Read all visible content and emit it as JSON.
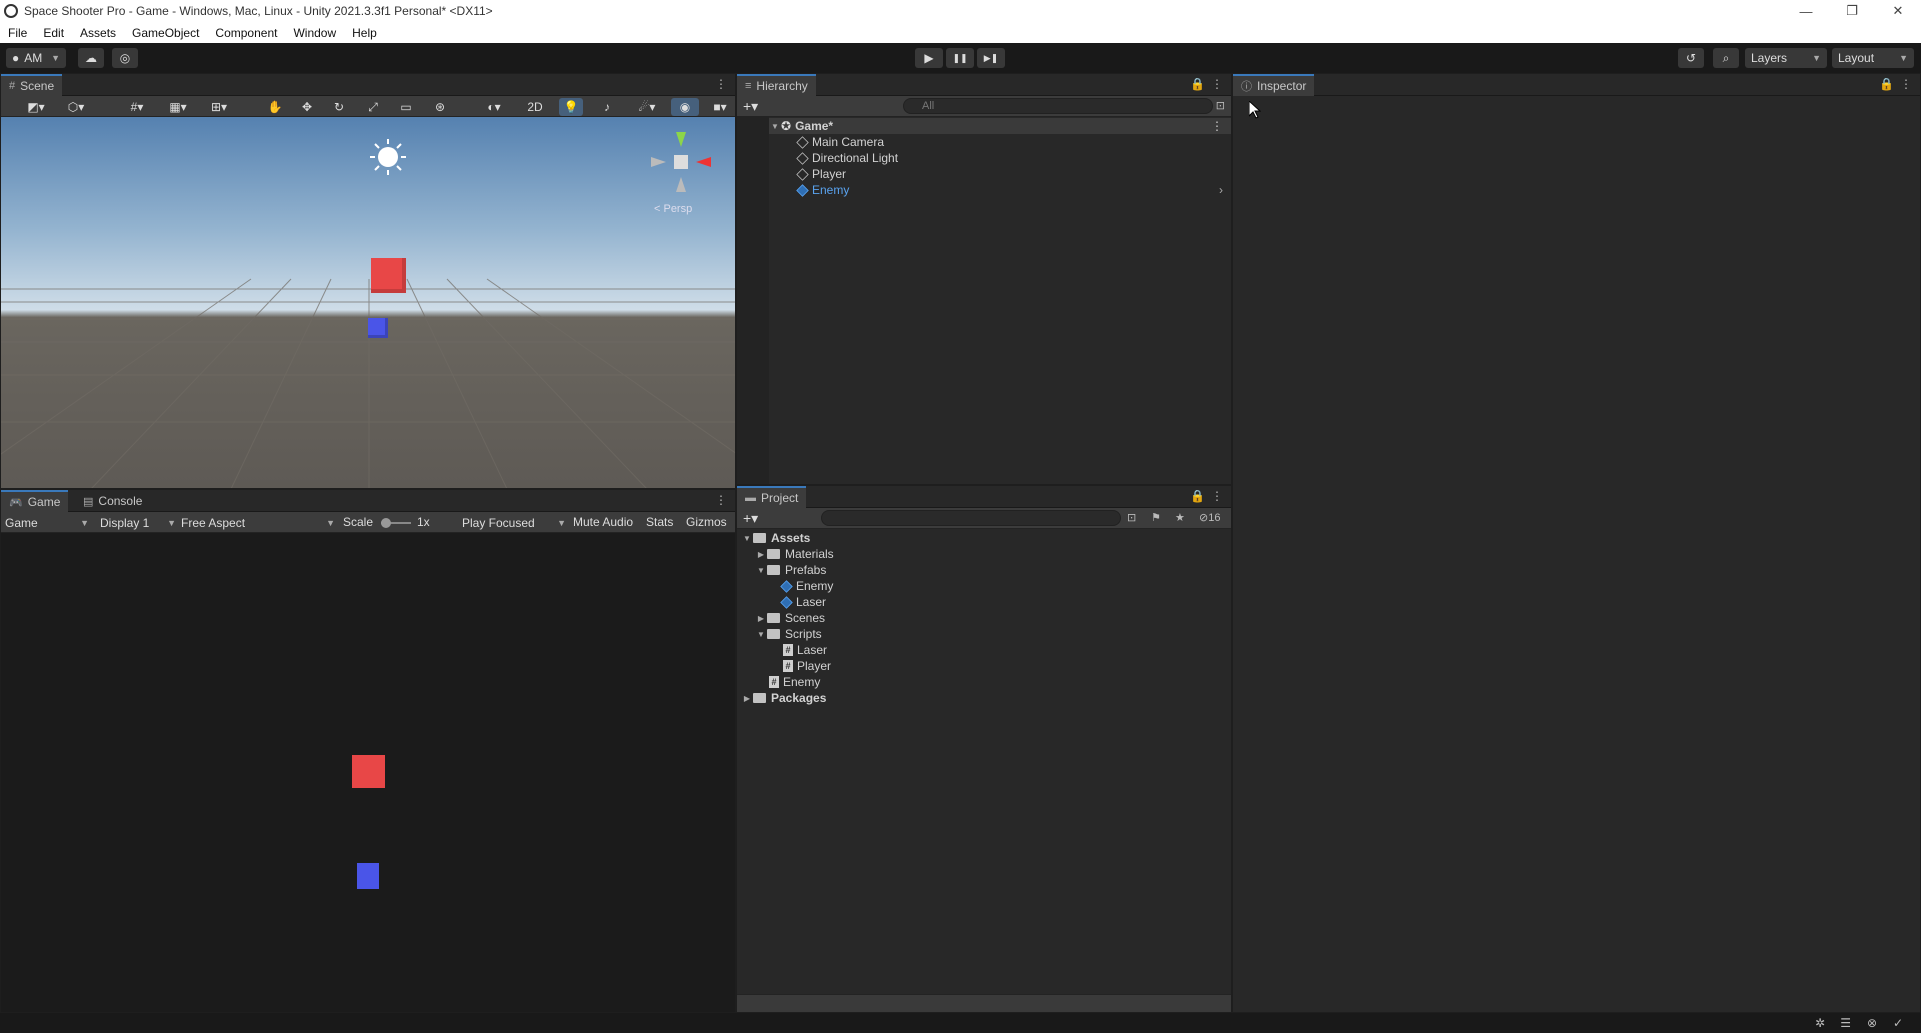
{
  "window": {
    "title": "Space Shooter Pro - Game - Windows, Mac, Linux - Unity 2021.3.3f1 Personal* <DX11>",
    "minimize": "—",
    "restore": "❐",
    "close": "✕"
  },
  "menu": [
    "File",
    "Edit",
    "Assets",
    "GameObject",
    "Component",
    "Window",
    "Help"
  ],
  "toolbar": {
    "account": "AM",
    "play_icon": "▶",
    "pause_icon": "❚❚",
    "step_icon": "▶❚",
    "layers": "Layers",
    "layout": "Layout"
  },
  "scene": {
    "tab": "Scene",
    "mode_2d": "2D",
    "gizmo_label": "< Persp"
  },
  "game": {
    "tab_game": "Game",
    "tab_console": "Console",
    "view": "Game",
    "display": "Display 1",
    "aspect": "Free Aspect",
    "scale_label": "Scale",
    "scale_value": "1x",
    "play_mode": "Play Focused",
    "mute": "Mute Audio",
    "stats": "Stats",
    "gizmos": "Gizmos"
  },
  "hierarchy": {
    "tab": "Hierarchy",
    "search_placeholder": "All",
    "scene_name": "Game*",
    "items": [
      "Main Camera",
      "Directional Light",
      "Player",
      "Enemy"
    ]
  },
  "project": {
    "tab": "Project",
    "hidden_count": "16",
    "tree": {
      "assets": "Assets",
      "materials": "Materials",
      "prefabs": "Prefabs",
      "prefab_enemy": "Enemy",
      "prefab_laser": "Laser",
      "scenes": "Scenes",
      "scripts": "Scripts",
      "script_laser": "Laser",
      "script_player": "Player",
      "enemy": "Enemy",
      "packages": "Packages"
    }
  },
  "inspector": {
    "tab": "Inspector"
  },
  "colors": {
    "accent": "#3a79bb",
    "selected_text": "#5aa3ef",
    "red_cube": "#e84747",
    "blue_cube": "#4a55e8"
  }
}
